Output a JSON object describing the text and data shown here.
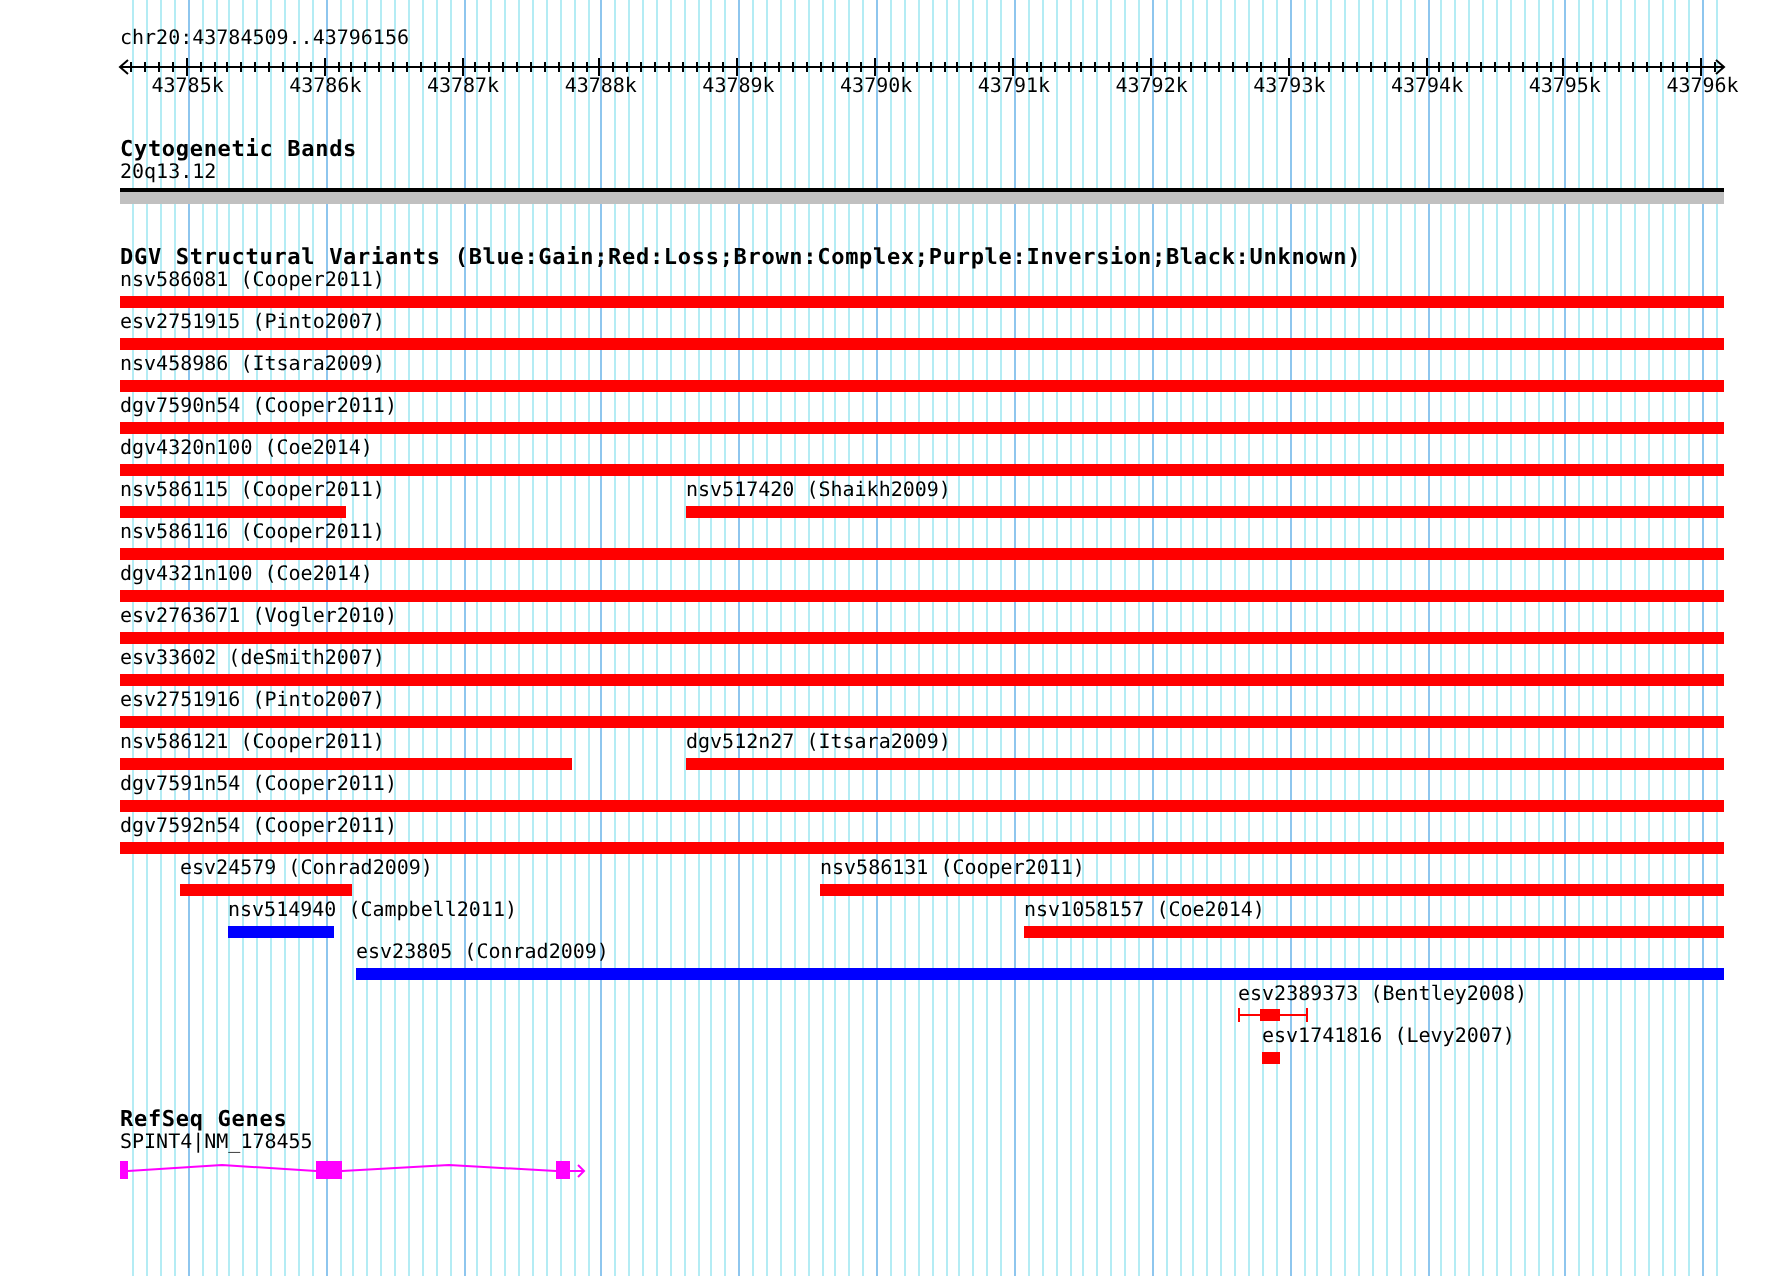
{
  "view": {
    "title": "chr20:43784509..43796156"
  },
  "ruler": {
    "ticks": [
      "43785k",
      "43786k",
      "43787k",
      "43788k",
      "43789k",
      "43790k",
      "43791k",
      "43792k",
      "43793k",
      "43794k",
      "43795k",
      "43796k"
    ]
  },
  "cytoband_track": {
    "title": "Cytogenetic Bands",
    "band": "20q13.12"
  },
  "variant_track": {
    "title": "DGV Structural Variants (Blue:Gain;Red:Loss;Brown:Complex;Purple:Inversion;Black:Unknown)",
    "rows": [
      {
        "features": [
          {
            "label": "nsv586081 (Cooper2011)",
            "color": "#ff0000",
            "kind": "bar"
          }
        ]
      },
      {
        "features": [
          {
            "label": "esv2751915 (Pinto2007)",
            "color": "#ff0000",
            "kind": "bar"
          }
        ]
      },
      {
        "features": [
          {
            "label": "nsv458986 (Itsara2009)",
            "color": "#ff0000",
            "kind": "bar"
          }
        ]
      },
      {
        "features": [
          {
            "label": "dgv7590n54 (Cooper2011)",
            "color": "#ff0000",
            "kind": "bar"
          }
        ]
      },
      {
        "features": [
          {
            "label": "dgv4320n100 (Coe2014)",
            "color": "#ff0000",
            "kind": "bar"
          }
        ]
      },
      {
        "features": [
          {
            "label": "nsv586115 (Cooper2011)",
            "color": "#ff0000",
            "kind": "bar"
          },
          {
            "label": "nsv517420 (Shaikh2009)",
            "color": "#ff0000",
            "kind": "bar"
          }
        ]
      },
      {
        "features": [
          {
            "label": "nsv586116 (Cooper2011)",
            "color": "#ff0000",
            "kind": "bar"
          }
        ]
      },
      {
        "features": [
          {
            "label": "dgv4321n100 (Coe2014)",
            "color": "#ff0000",
            "kind": "bar"
          }
        ]
      },
      {
        "features": [
          {
            "label": "esv2763671 (Vogler2010)",
            "color": "#ff0000",
            "kind": "bar"
          }
        ]
      },
      {
        "features": [
          {
            "label": "esv33602 (deSmith2007)",
            "color": "#ff0000",
            "kind": "bar"
          }
        ]
      },
      {
        "features": [
          {
            "label": "esv2751916 (Pinto2007)",
            "color": "#ff0000",
            "kind": "bar"
          }
        ]
      },
      {
        "features": [
          {
            "label": "nsv586121 (Cooper2011)",
            "color": "#ff0000",
            "kind": "bar"
          },
          {
            "label": "dgv512n27 (Itsara2009)",
            "color": "#ff0000",
            "kind": "bar"
          }
        ]
      },
      {
        "features": [
          {
            "label": "dgv7591n54 (Cooper2011)",
            "color": "#ff0000",
            "kind": "bar"
          }
        ]
      },
      {
        "features": [
          {
            "label": "dgv7592n54 (Cooper2011)",
            "color": "#ff0000",
            "kind": "bar"
          }
        ]
      },
      {
        "features": [
          {
            "label": "esv24579 (Conrad2009)",
            "color": "#ff0000",
            "kind": "bar"
          },
          {
            "label": "nsv586131 (Cooper2011)",
            "color": "#ff0000",
            "kind": "bar"
          }
        ]
      },
      {
        "features": [
          {
            "label": "nsv514940 (Campbell2011)",
            "color": "#0000ff",
            "kind": "bar"
          },
          {
            "label": "nsv1058157 (Coe2014)",
            "color": "#ff0000",
            "kind": "bar"
          }
        ]
      },
      {
        "features": [
          {
            "label": "esv23805 (Conrad2009)",
            "color": "#0000ff",
            "kind": "bar"
          }
        ]
      },
      {
        "features": [
          {
            "label": "esv2389373 (Bentley2008)",
            "color": "#ff0000",
            "kind": "whisker"
          }
        ]
      },
      {
        "features": [
          {
            "label": "esv1741816 (Levy2007)",
            "color": "#ff0000",
            "kind": "bar"
          }
        ]
      }
    ]
  },
  "gene_track": {
    "title": "RefSeq Genes",
    "genes": [
      {
        "label": "SPINT4|NM_178455"
      }
    ]
  }
}
